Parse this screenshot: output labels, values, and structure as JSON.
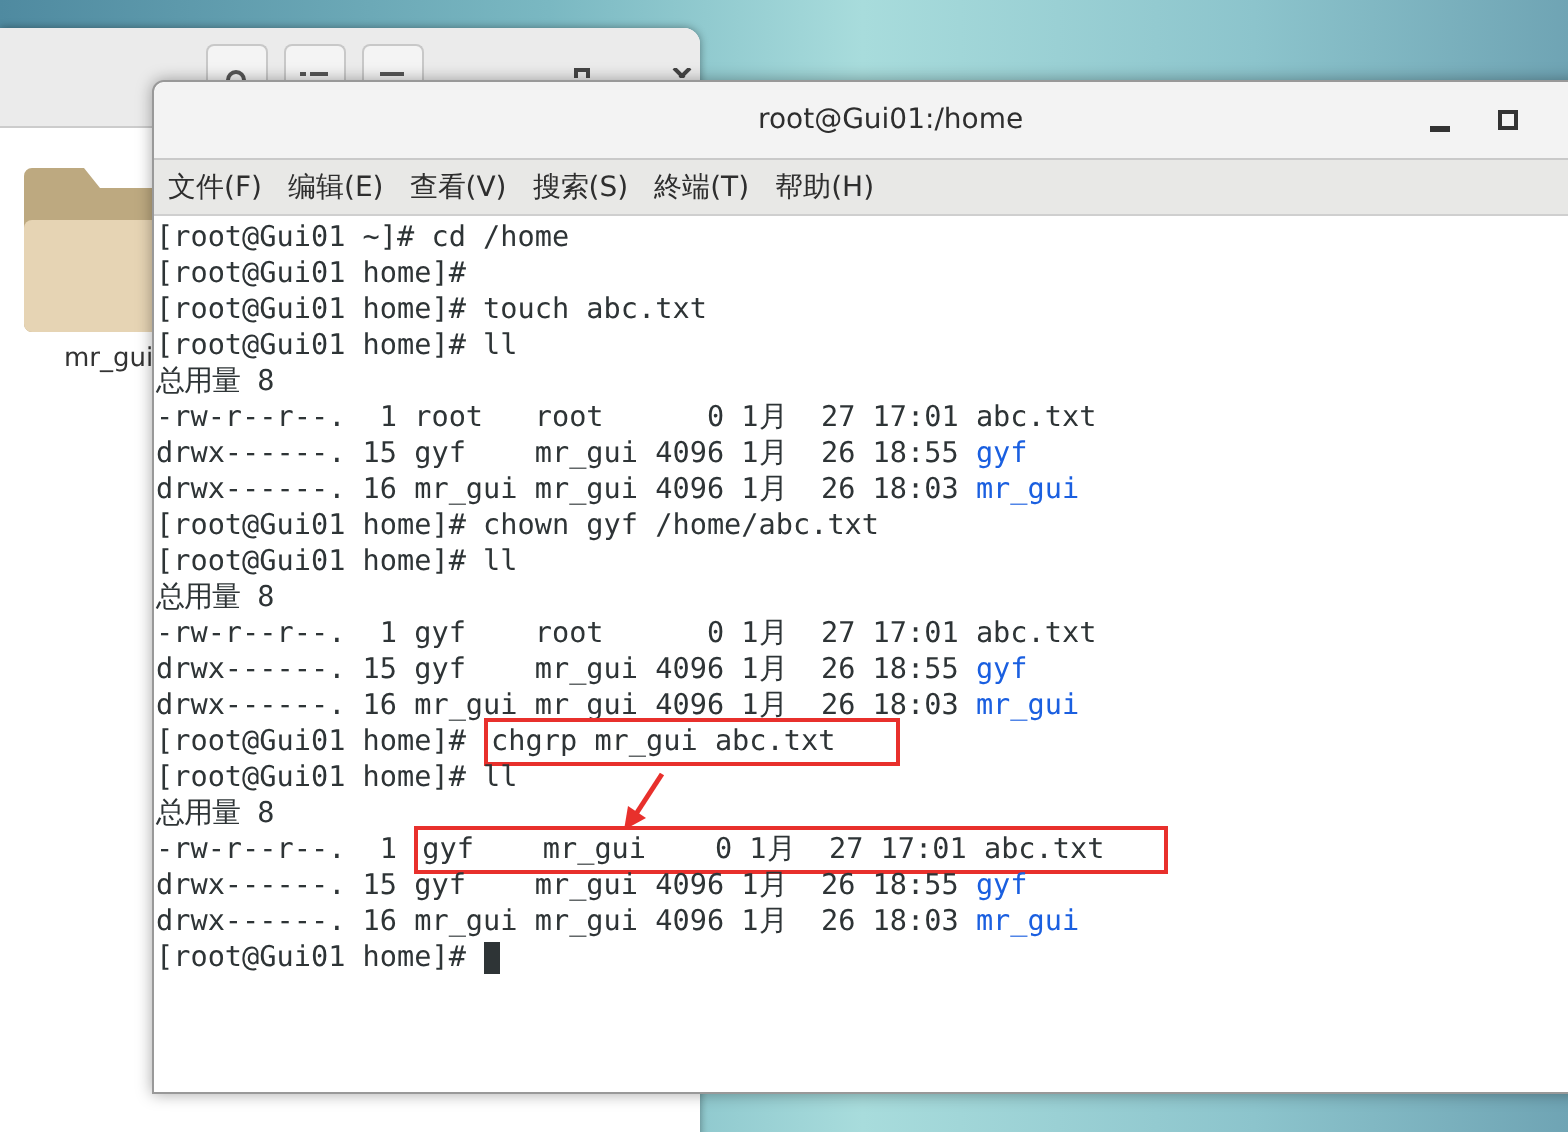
{
  "file_manager": {
    "folder": {
      "label": "mr_gui"
    }
  },
  "terminal": {
    "title": "root@Gui01:/home",
    "menu": [
      "文件(F)",
      "编辑(E)",
      "查看(V)",
      "搜索(S)",
      "終端(T)",
      "帮助(H)"
    ],
    "lines": [
      {
        "segments": [
          {
            "kind": "plain",
            "text": "[root@Gui01 ~]# cd /home"
          }
        ]
      },
      {
        "segments": [
          {
            "kind": "plain",
            "text": "[root@Gui01 home]#"
          }
        ]
      },
      {
        "segments": [
          {
            "kind": "plain",
            "text": "[root@Gui01 home]# touch abc.txt"
          }
        ]
      },
      {
        "segments": [
          {
            "kind": "plain",
            "text": "[root@Gui01 home]# ll"
          }
        ]
      },
      {
        "segments": [
          {
            "kind": "plain",
            "text": "总用量 8"
          }
        ]
      },
      {
        "segments": [
          {
            "kind": "plain",
            "text": "-rw-r--r--.  1 root   root      0 1月  27 17:01 abc.txt"
          }
        ]
      },
      {
        "segments": [
          {
            "kind": "plain",
            "text": "drwx------. 15 gyf    mr_gui 4096 1月  26 18:55 "
          },
          {
            "kind": "dir",
            "text": "gyf"
          }
        ]
      },
      {
        "segments": [
          {
            "kind": "plain",
            "text": "drwx------. 16 mr_gui mr_gui 4096 1月  26 18:03 "
          },
          {
            "kind": "dir",
            "text": "mr_gui"
          }
        ]
      },
      {
        "segments": [
          {
            "kind": "plain",
            "text": "[root@Gui01 home]# chown gyf /home/abc.txt"
          }
        ]
      },
      {
        "segments": [
          {
            "kind": "plain",
            "text": "[root@Gui01 home]# ll"
          }
        ]
      },
      {
        "segments": [
          {
            "kind": "plain",
            "text": "总用量 8"
          }
        ]
      },
      {
        "segments": [
          {
            "kind": "plain",
            "text": "-rw-r--r--.  1 gyf    root      0 1月  27 17:01 abc.txt"
          }
        ]
      },
      {
        "segments": [
          {
            "kind": "plain",
            "text": "drwx------. 15 gyf    mr_gui 4096 1月  26 18:55 "
          },
          {
            "kind": "dir",
            "text": "gyf"
          }
        ]
      },
      {
        "segments": [
          {
            "kind": "plain",
            "text": "drwx------. 16 mr_gui mr_gui 4096 1月  26 18:03 "
          },
          {
            "kind": "dir",
            "text": "mr_gui"
          }
        ]
      },
      {
        "segments": [
          {
            "kind": "plain",
            "text": "[root@Gui01 home]# "
          },
          {
            "kind": "boxed",
            "text": "chgrp mr_gui abc.txt"
          }
        ]
      },
      {
        "segments": [
          {
            "kind": "plain",
            "text": "[root@Gui01 home]# ll"
          }
        ]
      },
      {
        "segments": [
          {
            "kind": "plain",
            "text": "总用量 8"
          }
        ]
      },
      {
        "segments": [
          {
            "kind": "plain",
            "text": "-rw-r--r--.  1 "
          },
          {
            "kind": "boxed",
            "text": "gyf    mr_gui    0 1月  27 17:01 abc.txt"
          }
        ]
      },
      {
        "segments": [
          {
            "kind": "plain",
            "text": "drwx------. 15 gyf    mr_gui 4096 1月  26 18:55 "
          },
          {
            "kind": "dir",
            "text": "gyf"
          }
        ]
      },
      {
        "segments": [
          {
            "kind": "plain",
            "text": "drwx------. 16 mr_gui mr_gui 4096 1月  26 18:03 "
          },
          {
            "kind": "dir",
            "text": "mr_gui"
          }
        ]
      },
      {
        "segments": [
          {
            "kind": "plain",
            "text": "[root@Gui01 home]#"
          }
        ],
        "cursor": true
      }
    ]
  }
}
